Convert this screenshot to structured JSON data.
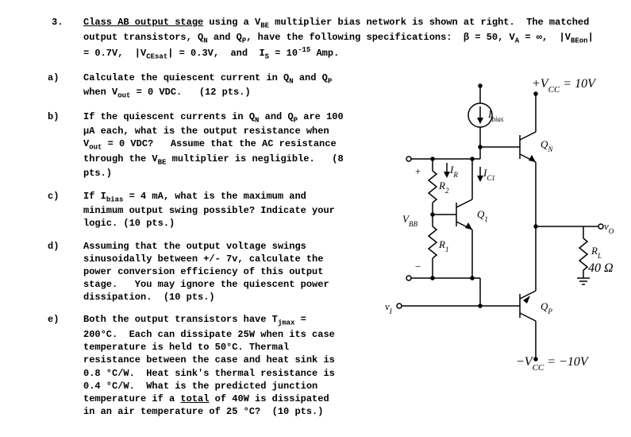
{
  "problem_number": "3.",
  "header_line": "Class AB output stage using a V_BE multiplier bias network is shown at right.  The matched output transistors, Q_N and Q_P, have the following specifications:  β = 50, V_A = ∞,  |V_BEon| = 0.7V,  |V_CEsat| = 0.3V,  and  I_S = 10^-15 Amp.",
  "parts": {
    "a": {
      "label": "a)",
      "text": "Calculate the quiescent current in Q_N and Q_P when V_out = 0 VDC.   (12 pts.)"
    },
    "b": {
      "label": "b)",
      "text": "If the quiescent currents in Q_N and Q_P are 100 µA each, what is the output resistance when  V_out = 0 VDC?   Assume that the AC resistance through the V_BE multiplier is negligible.   (8 pts.)"
    },
    "c": {
      "label": "c)",
      "text": "If I_bias = 4 mA, what is the maximum and minimum output swing possible?  Indicate your logic. (10 pts.)"
    },
    "d": {
      "label": "d)",
      "text": "Assuming that the output voltage swings sinusoidally between +/- 7v, calculate the power conversion efficiency of this output stage.   You may ignore the quiescent power dissipation.  (10 pts.)"
    },
    "e": {
      "label": "e)",
      "text": "Both the output transistors have T_jmax = 200°C.  Each can dissipate 25W when its case temperature is held to 50°C.  Thermal resistance between the case and heat sink is 0.8 °C/W.  Heat sink's thermal resistance is 0.4 °C/W.  What is the predicted junction temperature if a total of 40W is dissipated in an air temperature of 25 °C?  (10 pts.)"
    }
  },
  "circuit": {
    "vcc_plus": "+V_CC = 10V",
    "vcc_minus": "−V_CC = −10V",
    "ibias": "I_bias",
    "qn": "Q_N",
    "qp": "Q_P",
    "q1": "Q_1",
    "r1": "R_1",
    "r2": "R_2",
    "rl": "R_L",
    "rl_value": "40 Ω",
    "vbb": "V_BB",
    "ir": "I_R",
    "ic1": "I_C1",
    "vi": "v_I",
    "vo": "v_O",
    "plus": "+",
    "minus": "−"
  }
}
